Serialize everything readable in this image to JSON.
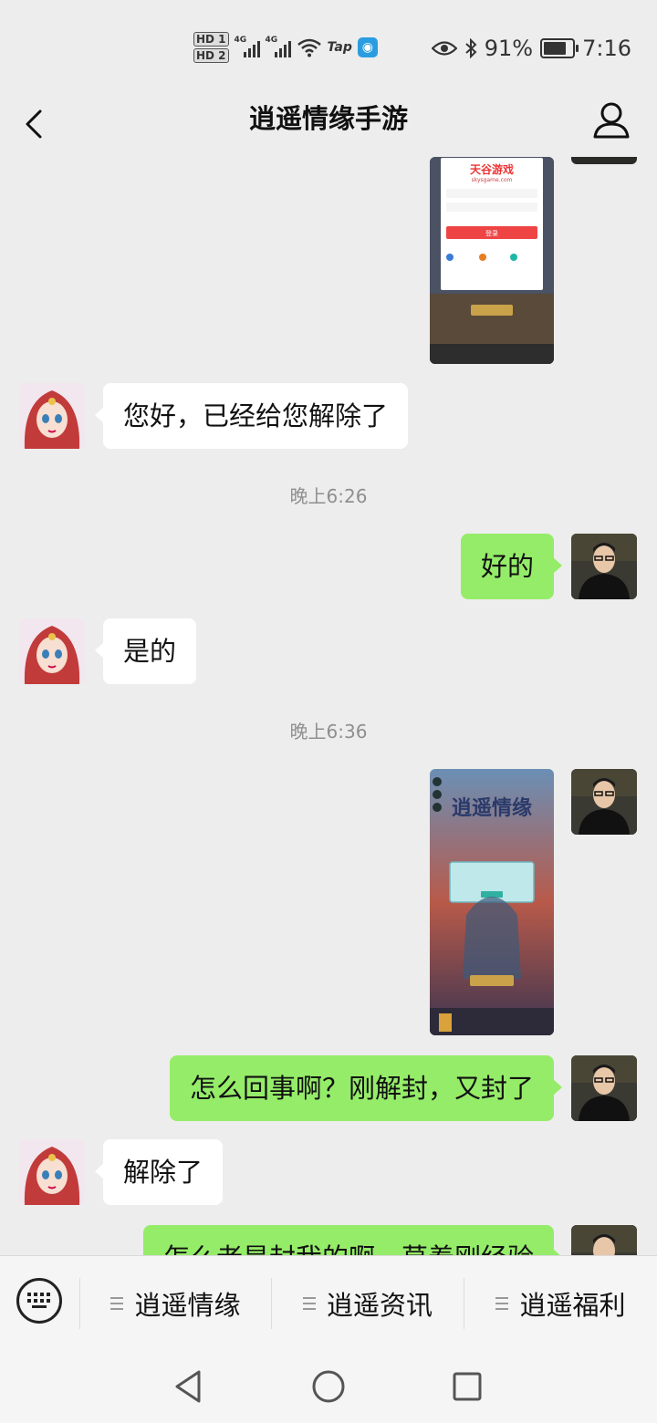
{
  "status_bar": {
    "hd1": "HD 1",
    "hd2": "HD 2",
    "net1": "4G",
    "net2": "4G",
    "tap_label": "Tap",
    "battery": "91%",
    "battery_level": 0.91,
    "time": "7:16"
  },
  "header": {
    "title": "逍遥情缘手游"
  },
  "messages": [
    {
      "type": "image",
      "side": "right",
      "desc": "login-screenshot",
      "screenshot": {
        "brand": "天谷游戏",
        "domain": "skysgame.com",
        "login_btn": "登录"
      }
    },
    {
      "type": "text",
      "side": "left",
      "text": "您好，已经给您解除了"
    },
    {
      "type": "time",
      "text": "晚上6:26"
    },
    {
      "type": "text",
      "side": "right",
      "text": "好的"
    },
    {
      "type": "text",
      "side": "left",
      "text": "是的"
    },
    {
      "type": "time",
      "text": "晚上6:36"
    },
    {
      "type": "image",
      "side": "right",
      "desc": "game-screenshot",
      "screenshot": {
        "game_title": "逍遥情缘"
      }
    },
    {
      "type": "text",
      "side": "right",
      "text": "怎么回事啊？刚解封，又封了"
    },
    {
      "type": "text",
      "side": "left",
      "text": "解除了"
    },
    {
      "type": "text",
      "side": "right",
      "text": "怎么老是封我的啊，莫着刚经验"
    }
  ],
  "menu": {
    "items": [
      "逍遥情缘",
      "逍遥资讯",
      "逍遥福利"
    ]
  },
  "nav": {
    "icons": [
      "back-triangle-icon",
      "home-circle-icon",
      "recents-square-icon"
    ]
  },
  "colors": {
    "background": "#ededed",
    "bubble_self": "#95ec69",
    "bubble_other": "#ffffff",
    "timestamp": "#8f8f8f"
  }
}
